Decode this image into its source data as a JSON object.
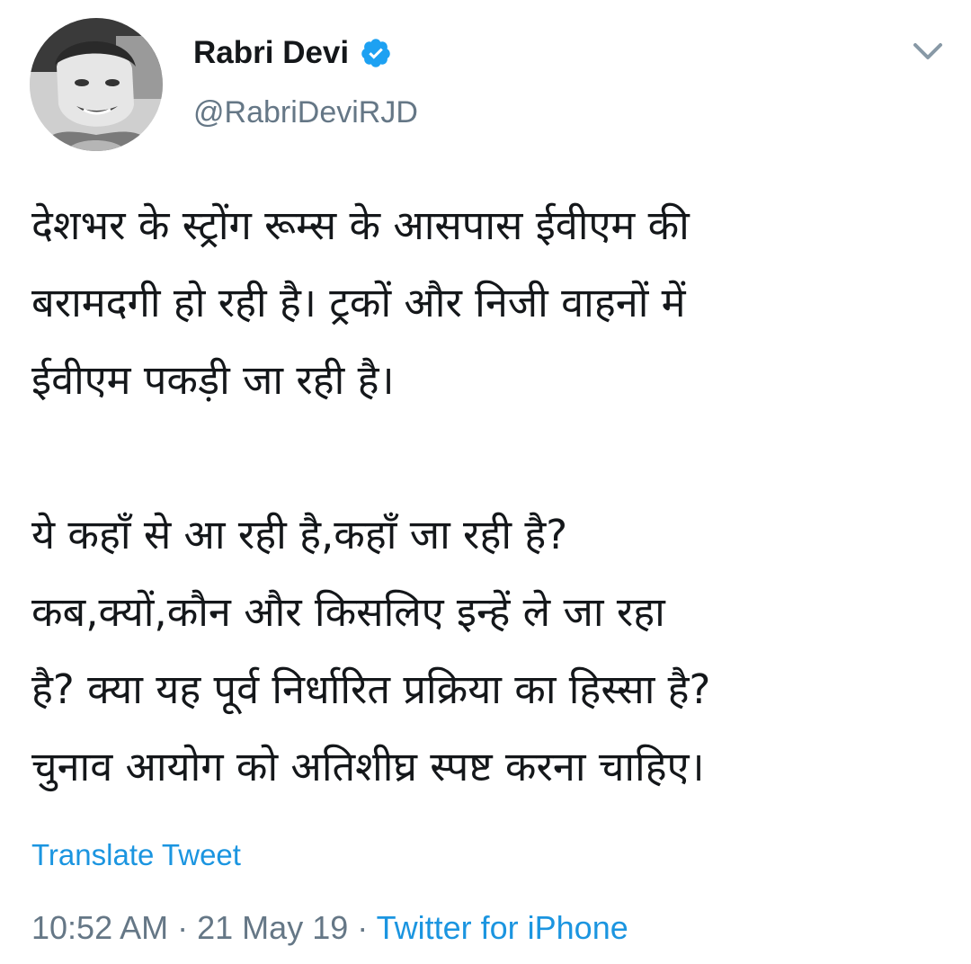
{
  "author": {
    "display_name": "Rabri Devi",
    "handle": "@RabriDeviRJD",
    "verified_icon": "verified-badge-icon",
    "avatar_icon": "avatar-photo"
  },
  "menu": {
    "icon": "chevron-down-icon"
  },
  "tweet": {
    "lines": [
      "देशभर के स्ट्रोंग रूम्स के आसपास ईवीएम की",
      "बरामदगी हो रही है। ट्रकों और निजी वाहनों में",
      "ईवीएम पकड़ी जा रही है।",
      "",
      "ये कहाँ से आ रही है,कहाँ जा रही है?",
      "कब,क्यों,कौन और किसलिए इन्हें ले जा रहा",
      "है? क्या यह पूर्व निर्धारित प्रक्रिया का हिस्सा है?",
      "चुनाव आयोग को अतिशीघ्र स्पष्ट करना चाहिए।"
    ],
    "translate_label": "Translate Tweet",
    "time": "10:52 AM",
    "separator": "·",
    "date": "21 May 19",
    "source": "Twitter for iPhone"
  },
  "colors": {
    "link_blue": "#1b95e0",
    "secondary_gray": "#657786",
    "text_primary": "#14171a",
    "verified_blue": "#1da1f2"
  }
}
